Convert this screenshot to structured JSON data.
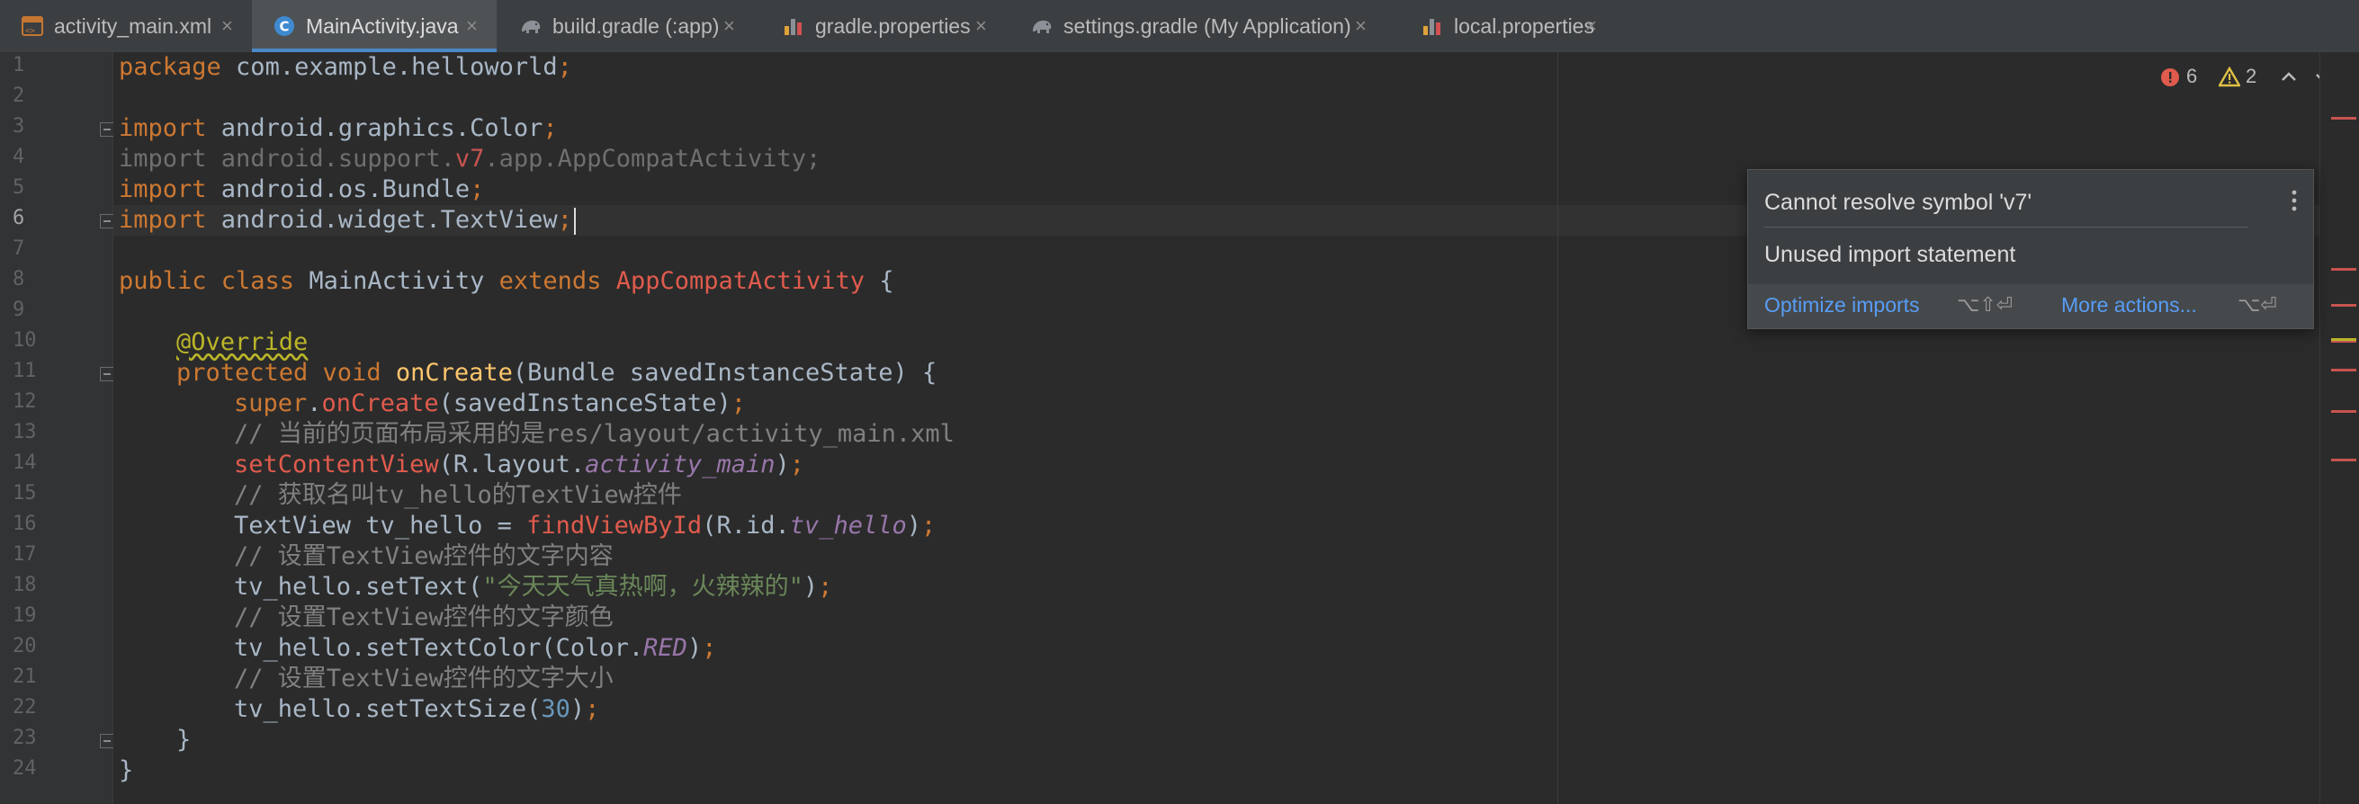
{
  "tabs": [
    {
      "label": "activity_main.xml",
      "icon": "xml-layout-icon",
      "active": false
    },
    {
      "label": "MainActivity.java",
      "icon": "java-class-icon",
      "active": true
    },
    {
      "label": "build.gradle (:app)",
      "icon": "gradle-elephant-icon",
      "active": false
    },
    {
      "label": "gradle.properties",
      "icon": "properties-bar-chart-icon",
      "active": false
    },
    {
      "label": "settings.gradle (My Application)",
      "icon": "gradle-elephant-icon",
      "active": false
    },
    {
      "label": "local.properties",
      "icon": "properties-bar-chart-icon",
      "active": false
    }
  ],
  "close_glyph": "×",
  "editor": {
    "line_numbers": [
      "1",
      "2",
      "3",
      "4",
      "5",
      "6",
      "7",
      "8",
      "9",
      "10",
      "11",
      "12",
      "13",
      "14",
      "15",
      "16",
      "17",
      "18",
      "19",
      "20",
      "21",
      "22",
      "23",
      "24"
    ],
    "current_line": "6",
    "code": {
      "l1_kw": "package",
      "l1_rest": " com.example.helloworld",
      "l1_semi": ";",
      "l3_kw": "import",
      "l3_rest": " android.graphics.Color",
      "l3_semi": ";",
      "l4_kw": "import",
      "l4_a": " android.support.",
      "l4_b": "v7",
      "l4_c": ".app.AppCompatActivity;",
      "l5_kw": "import",
      "l5_rest": " android.os.Bundle",
      "l5_semi": ";",
      "l6_kw": "import",
      "l6_rest": " android.widget.TextView",
      "l6_semi": ";",
      "l8_kw1": "public class",
      "l8_name": " MainActivity ",
      "l8_kw2": "extends",
      "l8_sup": " AppCompatActivity",
      "l8_brace": " {",
      "l10_ann": "@Override",
      "l11_kw": "protected void",
      "l11_fn": " onCreate",
      "l11_rest": "(Bundle savedInstanceState) {",
      "l12_kw": "super",
      "l12_dot": ".",
      "l12_call": "onCreate",
      "l12_rest": "(savedInstanceState)",
      "l12_semi": ";",
      "l13_cm": "// 当前的页面布局采用的是res/layout/activity_main.xml",
      "l14_call": "setContentView",
      "l14_a": "(R.layout.",
      "l14_it": "activity_main",
      "l14_b": ")",
      "l14_semi": ";",
      "l15_cm": "// 获取名叫tv_hello的TextView控件",
      "l16_a": "TextView tv_hello = ",
      "l16_call": "findViewById",
      "l16_b": "(R.id.",
      "l16_it": "tv_hello",
      "l16_c": ")",
      "l16_semi": ";",
      "l17_cm": "// 设置TextView控件的文字内容",
      "l18_a": "tv_hello.setText(",
      "l18_str": "\"今天天气真热啊，火辣辣的\"",
      "l18_b": ")",
      "l18_semi": ";",
      "l19_cm": "// 设置TextView控件的文字颜色",
      "l20_a": "tv_hello.setTextColor(Color.",
      "l20_it": "RED",
      "l20_b": ")",
      "l20_semi": ";",
      "l21_cm": "// 设置TextView控件的文字大小",
      "l22_a": "tv_hello.setTextSize(",
      "l22_num": "30",
      "l22_b": ")",
      "l22_semi": ";",
      "l23": "}",
      "l24": "}"
    }
  },
  "inspection": {
    "errors": "6",
    "warnings": "2",
    "error_icon": "error-circle-icon",
    "warning_icon": "warning-triangle-icon"
  },
  "popup": {
    "message1": "Cannot resolve symbol 'v7'",
    "message2": "Unused import statement",
    "action1": "Optimize imports",
    "action1_shortcut": "⌥⇧⏎",
    "action2": "More actions...",
    "action2_shortcut": "⌥⏎"
  },
  "colors": {
    "accent": "#4a88c7",
    "keyword": "#cc7832",
    "error": "#e05b4d",
    "warning": "#bbb529",
    "link": "#589df6"
  }
}
